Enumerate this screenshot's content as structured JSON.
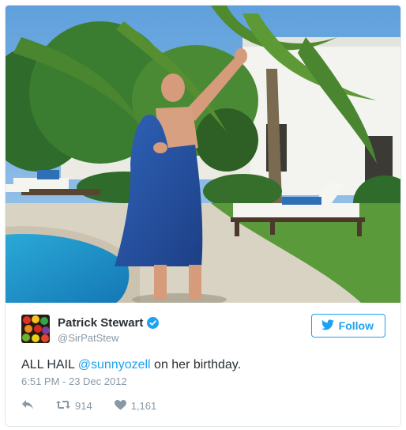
{
  "tweet": {
    "author_name": "Patrick Stewart",
    "handle": "@SirPatStew",
    "follow_label": "Follow",
    "text_prefix": "ALL HAIL ",
    "mention": "@sunnyozell",
    "text_suffix": " on her birthday.",
    "timestamp": "6:51 PM - 23 Dec 2012",
    "retweet_count": "914",
    "like_count": "1,161"
  },
  "colors": {
    "accent": "#1da1f2",
    "text": "#292f33",
    "muted": "#8899a6"
  },
  "icons": [
    "verified-badge-icon",
    "twitter-bird-icon",
    "reply-icon",
    "retweet-icon",
    "heart-icon"
  ]
}
